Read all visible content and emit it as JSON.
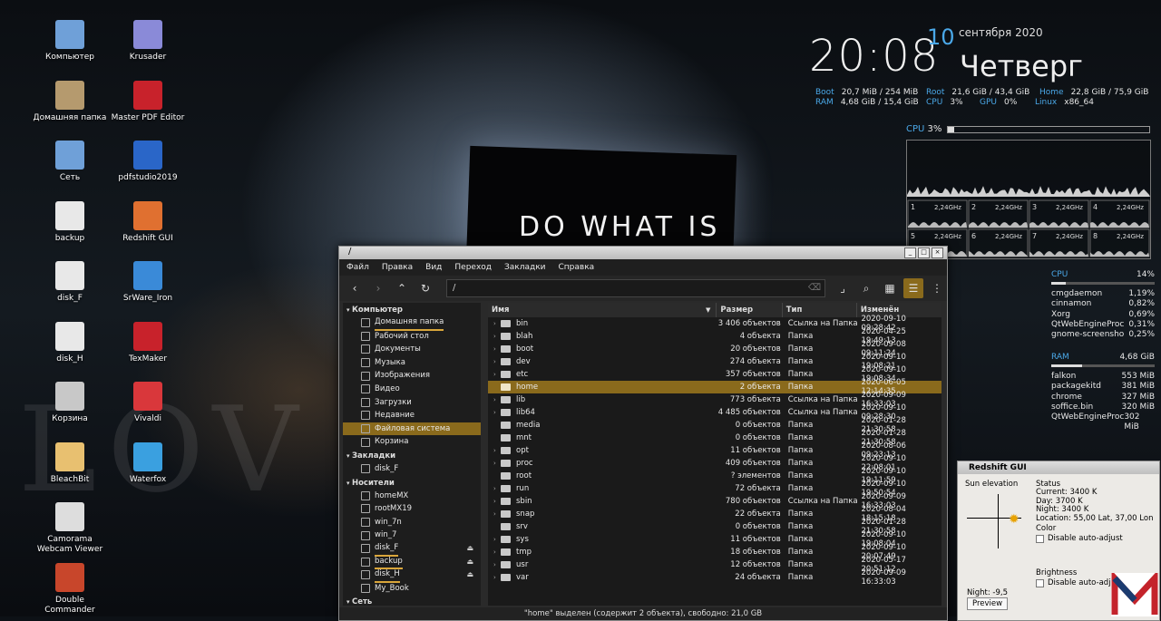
{
  "wallpaper": {
    "poster_text": "DO WHAT IS",
    "bg_word": "LOV"
  },
  "desktop_icons": [
    {
      "label": "Компьютер",
      "icon": "computer-icon",
      "col": 0,
      "row": 0
    },
    {
      "label": "Домашняя папка",
      "icon": "home-folder-icon",
      "col": 0,
      "row": 1
    },
    {
      "label": "Сеть",
      "icon": "network-icon",
      "col": 0,
      "row": 2
    },
    {
      "label": "backup",
      "icon": "drive-icon",
      "col": 0,
      "row": 3
    },
    {
      "label": "disk_F",
      "icon": "drive-icon",
      "col": 0,
      "row": 4
    },
    {
      "label": "disk_H",
      "icon": "drive-icon",
      "col": 0,
      "row": 5
    },
    {
      "label": "Корзина",
      "icon": "trash-icon",
      "col": 0,
      "row": 6
    },
    {
      "label": "BleachBit",
      "icon": "bleachbit-icon",
      "col": 0,
      "row": 7
    },
    {
      "label": "Camorama Webcam Viewer",
      "icon": "webcam-icon",
      "col": 0,
      "row": 8
    },
    {
      "label": "Double Commander",
      "icon": "doublecommander-icon",
      "col": 0,
      "row": 9
    },
    {
      "label": "Krusader",
      "icon": "krusader-icon",
      "col": 1,
      "row": 0
    },
    {
      "label": "Master PDF Editor",
      "icon": "pdf-editor-icon",
      "col": 1,
      "row": 1
    },
    {
      "label": "pdfstudio2019",
      "icon": "pdfstudio-icon",
      "col": 1,
      "row": 2
    },
    {
      "label": "Redshift GUI",
      "icon": "redshift-icon",
      "col": 1,
      "row": 3
    },
    {
      "label": "SrWare_Iron",
      "icon": "iron-browser-icon",
      "col": 1,
      "row": 4
    },
    {
      "label": "TexMaker",
      "icon": "texmaker-icon",
      "col": 1,
      "row": 5
    },
    {
      "label": "Vivaldi",
      "icon": "vivaldi-icon",
      "col": 1,
      "row": 6
    },
    {
      "label": "Waterfox",
      "icon": "waterfox-icon",
      "col": 1,
      "row": 7
    }
  ],
  "conky": {
    "time": "20:08",
    "day": "10",
    "month_year": "сентября 2020",
    "weekday": "Четверг",
    "stats": [
      {
        "k": "Boot",
        "v": "20,7 MiB / 254 MiB"
      },
      {
        "k": "Root",
        "v": "21,6 GiB / 43,4 GiB"
      },
      {
        "k": "Home",
        "v": "22,8 GiB / 75,9 GiB"
      },
      {
        "k": "RAM",
        "v": "4,68 GiB / 15,4 GiB"
      },
      {
        "k": "CPU",
        "v": "3%"
      },
      {
        "k": "GPU",
        "v": "0%"
      },
      {
        "k": "Linux",
        "v": "x86_64"
      }
    ],
    "cpu_label": "CPU",
    "cpu_value": "3%",
    "cpu_fraction": 0.03,
    "cores": [
      {
        "n": "1",
        "f": "2,24GHz"
      },
      {
        "n": "2",
        "f": "2,24GHz"
      },
      {
        "n": "3",
        "f": "2,24GHz"
      },
      {
        "n": "4",
        "f": "2,24GHz"
      },
      {
        "n": "5",
        "f": "2,24GHz"
      },
      {
        "n": "6",
        "f": "2,24GHz"
      },
      {
        "n": "7",
        "f": "2,24GHz"
      },
      {
        "n": "8",
        "f": "2,24GHz"
      }
    ],
    "top_cpu": {
      "label": "CPU",
      "total": "14%",
      "fraction": 0.14,
      "procs": [
        {
          "name": "cmgdaemon",
          "val": "1,19%"
        },
        {
          "name": "cinnamon",
          "val": "0,82%"
        },
        {
          "name": "Xorg",
          "val": "0,69%"
        },
        {
          "name": "QtWebEngineProc",
          "val": "0,31%"
        },
        {
          "name": "gnome-screensho",
          "val": "0,25%"
        }
      ]
    },
    "top_ram": {
      "label": "RAM",
      "total": "4,68 GiB",
      "fraction": 0.3,
      "procs": [
        {
          "name": "falkon",
          "val": "553 MiB"
        },
        {
          "name": "packagekitd",
          "val": "381 MiB"
        },
        {
          "name": "chrome",
          "val": "327 MiB"
        },
        {
          "name": "soffice.bin",
          "val": "320 MiB"
        },
        {
          "name": "QtWebEngineProc",
          "val": "302 MiB"
        }
      ]
    }
  },
  "fm": {
    "title": "/",
    "menu": [
      "Файл",
      "Правка",
      "Вид",
      "Переход",
      "Закладки",
      "Справка"
    ],
    "path": "/",
    "sidebar": [
      {
        "type": "hdr",
        "label": "Компьютер"
      },
      {
        "label": "Домашняя папка",
        "icon": "home-icon",
        "ul": true
      },
      {
        "label": "Рабочий стол",
        "icon": "desktop-folder-icon"
      },
      {
        "label": "Документы",
        "icon": "documents-icon"
      },
      {
        "label": "Музыка",
        "icon": "music-icon"
      },
      {
        "label": "Изображения",
        "icon": "pictures-icon"
      },
      {
        "label": "Видео",
        "icon": "video-icon"
      },
      {
        "label": "Загрузки",
        "icon": "downloads-icon"
      },
      {
        "label": "Недавние",
        "icon": "recent-icon"
      },
      {
        "label": "Файловая система",
        "icon": "filesystem-icon",
        "sel": true
      },
      {
        "label": "Корзина",
        "icon": "trash-icon"
      },
      {
        "type": "hdr",
        "label": "Закладки"
      },
      {
        "label": "disk_F",
        "icon": "folder-icon"
      },
      {
        "type": "hdr",
        "label": "Носители"
      },
      {
        "label": "homeMX",
        "icon": "drive-icon"
      },
      {
        "label": "rootMX19",
        "icon": "drive-icon"
      },
      {
        "label": "win_7n",
        "icon": "drive-icon"
      },
      {
        "label": "win_7",
        "icon": "drive-icon"
      },
      {
        "label": "disk_F",
        "icon": "drive-icon",
        "eject": "⏏",
        "ul": true
      },
      {
        "label": "backup",
        "icon": "drive-icon",
        "eject": "⏏",
        "ul": true
      },
      {
        "label": "disk_H",
        "icon": "drive-icon",
        "eject": "⏏",
        "ul": true
      },
      {
        "label": "My_Book",
        "icon": "drive-icon"
      },
      {
        "type": "hdr",
        "label": "Сеть"
      }
    ],
    "columns": {
      "name": "Имя",
      "size": "Размер",
      "type": "Тип",
      "modified": "Изменён"
    },
    "rows": [
      {
        "n": "bin",
        "arrow": "›",
        "s": "3 406 объектов",
        "t": "Ссылка на Папка",
        "d": "2020-09-10 09:28:42"
      },
      {
        "n": "blah",
        "arrow": "›",
        "s": "4 объекта",
        "t": "Папка",
        "d": "2020-04-25 19:49:13"
      },
      {
        "n": "boot",
        "arrow": "›",
        "s": "20 объектов",
        "t": "Папка",
        "d": "2020-09-08 09:11:24"
      },
      {
        "n": "dev",
        "arrow": "›",
        "s": "274 объекта",
        "t": "Папка",
        "d": "2020-09-10 19:08:21"
      },
      {
        "n": "etc",
        "arrow": "›",
        "s": "357 объектов",
        "t": "Папка",
        "d": "2020-09-10 19:08:34"
      },
      {
        "n": "home",
        "arrow": "",
        "s": "2 объекта",
        "t": "Папка",
        "d": "2020-06-05 12:14:35",
        "sel": true
      },
      {
        "n": "lib",
        "arrow": "›",
        "s": "773 объекта",
        "t": "Ссылка на Папка",
        "d": "2020-09-09 16:33:03"
      },
      {
        "n": "lib64",
        "arrow": "›",
        "s": "4 485 объектов",
        "t": "Ссылка на Папка",
        "d": "2020-09-10 09:28:30"
      },
      {
        "n": "media",
        "arrow": "",
        "s": "0 объектов",
        "t": "Папка",
        "d": "2020-01-28 21:30:58"
      },
      {
        "n": "mnt",
        "arrow": "",
        "s": "0 объектов",
        "t": "Папка",
        "d": "2020-01-28 21:30:58"
      },
      {
        "n": "opt",
        "arrow": "›",
        "s": "11 объектов",
        "t": "Папка",
        "d": "2020-08-06 09:23:13"
      },
      {
        "n": "proc",
        "arrow": "›",
        "s": "409 объектов",
        "t": "Папка",
        "d": "2020-09-10 22:08:01"
      },
      {
        "n": "root",
        "arrow": "",
        "s": "? элементов",
        "t": "Папка",
        "d": "2020-09-10 19:11:59"
      },
      {
        "n": "run",
        "arrow": "›",
        "s": "72 объекта",
        "t": "Папка",
        "d": "2020-09-10 19:50:54"
      },
      {
        "n": "sbin",
        "arrow": "›",
        "s": "780 объектов",
        "t": "Ссылка на Папка",
        "d": "2020-09-09 16:33:03"
      },
      {
        "n": "snap",
        "arrow": "›",
        "s": "22 объекта",
        "t": "Папка",
        "d": "2020-08-04 18:15:18"
      },
      {
        "n": "srv",
        "arrow": "",
        "s": "0 объектов",
        "t": "Папка",
        "d": "2020-01-28 21:30:58"
      },
      {
        "n": "sys",
        "arrow": "›",
        "s": "11 объектов",
        "t": "Папка",
        "d": "2020-09-10 19:08:04"
      },
      {
        "n": "tmp",
        "arrow": "›",
        "s": "18 объектов",
        "t": "Папка",
        "d": "2020-09-10 20:07:49"
      },
      {
        "n": "usr",
        "arrow": "›",
        "s": "12 объектов",
        "t": "Папка",
        "d": "2020-05-17 20:51:12"
      },
      {
        "n": "var",
        "arrow": "›",
        "s": "24 объекта",
        "t": "Папка",
        "d": "2020-09-09 16:33:03"
      }
    ],
    "status": "\"home\" выделен (содержит 2 объекта), свободно: 21,0 GB"
  },
  "redshift": {
    "title": "Redshift GUI",
    "sun_label": "Sun elevation",
    "status_label": "Status",
    "current_label": "Current:",
    "current": "3400 K",
    "day_label": "Day:",
    "day": "3700 K",
    "night_label": "Night:",
    "night": "3400 K",
    "location_label": "Location:",
    "location": "55,00 Lat, 37,00 Lon",
    "color_label": "Color",
    "disable1": "Disable auto-adjust",
    "brightness_label": "Brightness",
    "disable2": "Disable auto-adjust",
    "night_elev": "Night: -9,5",
    "preview": "Preview"
  }
}
